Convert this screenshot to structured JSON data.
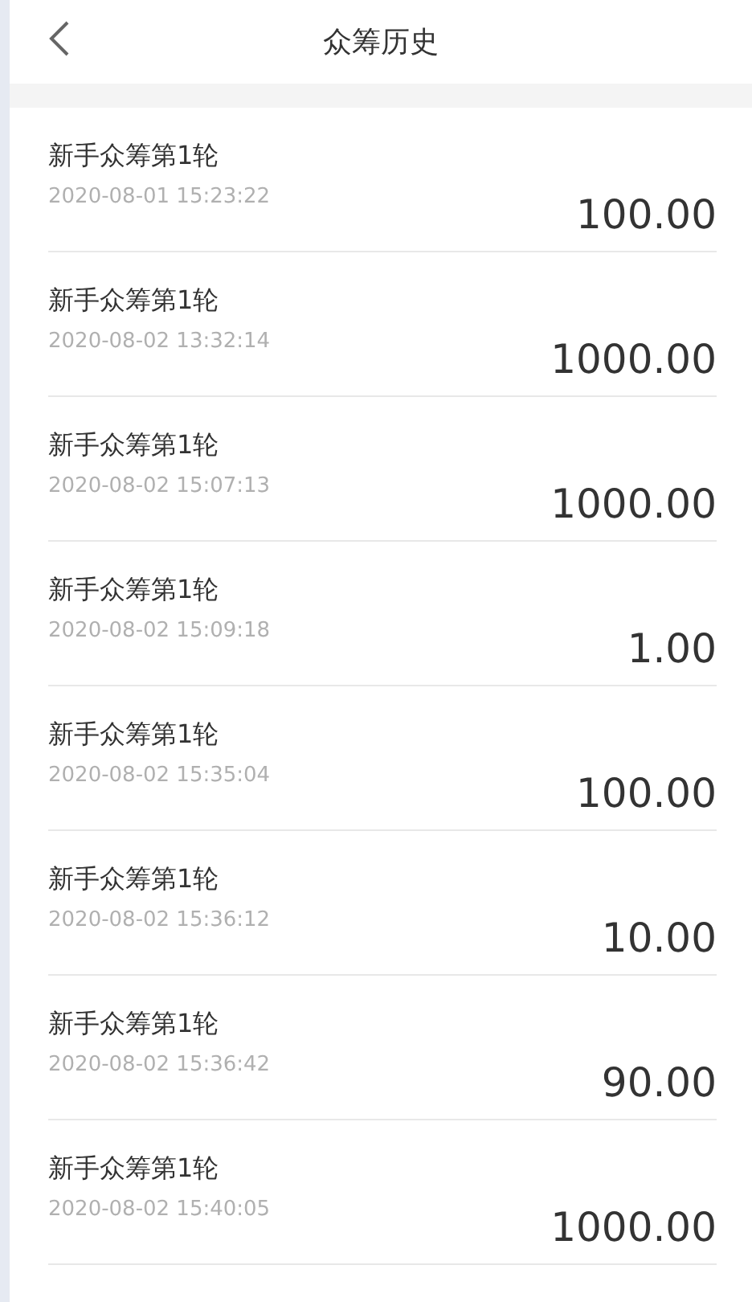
{
  "header": {
    "title": "众筹历史"
  },
  "records": [
    {
      "name": "新手众筹第1轮",
      "time": "2020-08-01 15:23:22",
      "amount": "100.00"
    },
    {
      "name": "新手众筹第1轮",
      "time": "2020-08-02 13:32:14",
      "amount": "1000.00"
    },
    {
      "name": "新手众筹第1轮",
      "time": "2020-08-02 15:07:13",
      "amount": "1000.00"
    },
    {
      "name": "新手众筹第1轮",
      "time": "2020-08-02 15:09:18",
      "amount": "1.00"
    },
    {
      "name": "新手众筹第1轮",
      "time": "2020-08-02 15:35:04",
      "amount": "100.00"
    },
    {
      "name": "新手众筹第1轮",
      "time": "2020-08-02 15:36:12",
      "amount": "10.00"
    },
    {
      "name": "新手众筹第1轮",
      "time": "2020-08-02 15:36:42",
      "amount": "90.00"
    },
    {
      "name": "新手众筹第1轮",
      "time": "2020-08-02 15:40:05",
      "amount": "1000.00"
    }
  ]
}
